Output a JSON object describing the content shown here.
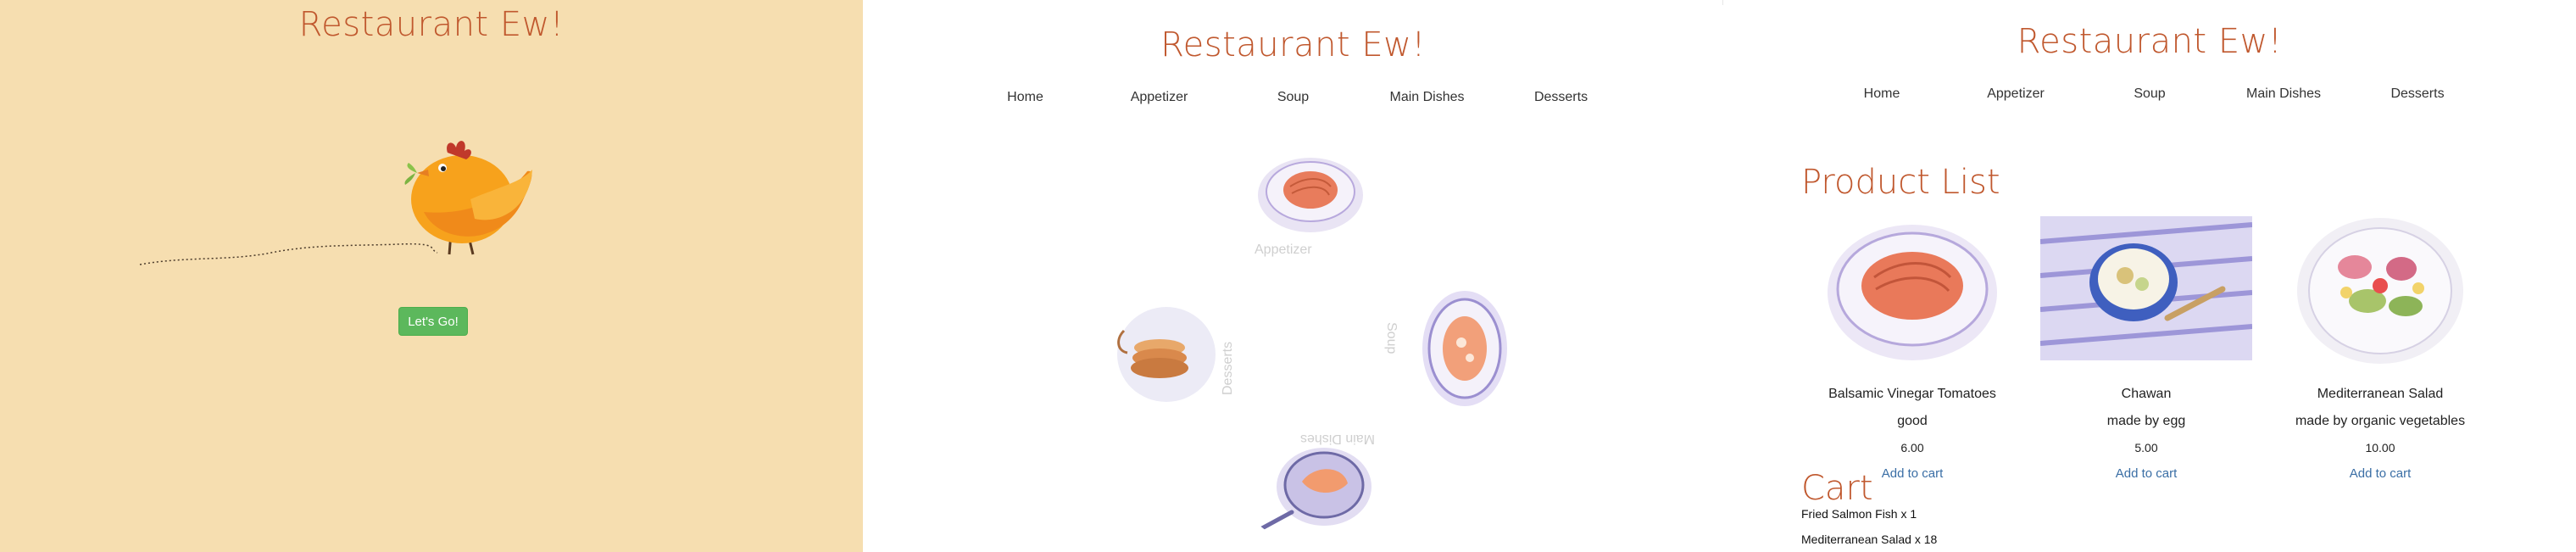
{
  "welcome": {
    "brand": "Restaurant Ew!",
    "cta_label": "Let's Go!"
  },
  "menu_page": {
    "brand": "Restaurant Ew!",
    "nav": [
      "Home",
      "Appetizer",
      "Soup",
      "Main Dishes",
      "Desserts"
    ],
    "wheel_labels": {
      "top": "Appetizer",
      "right": "Soup",
      "bottom": "Main Dishes",
      "left": "Desserts"
    }
  },
  "products_page": {
    "brand": "Restaurant Ew!",
    "nav": [
      "Home",
      "Appetizer",
      "Soup",
      "Main Dishes",
      "Desserts"
    ],
    "product_list_title": "Product List",
    "products": [
      {
        "name": "Balsamic Vinegar Tomatoes",
        "desc": "good",
        "price": "6.00",
        "action": "Add to cart"
      },
      {
        "name": "Chawan",
        "desc": "made by egg",
        "price": "5.00",
        "action": "Add to cart"
      },
      {
        "name": "Mediterranean Salad",
        "desc": "made by organic vegetables",
        "price": "10.00",
        "action": "Add to cart"
      }
    ],
    "cart_title": "Cart",
    "cart_items": [
      "Fried Salmon Fish x 1",
      "Mediterranean Salad x 18"
    ]
  },
  "colors": {
    "welcome_bg": "#f6deb0",
    "brand_color": "#c0582e",
    "button_green": "#5cb85c",
    "link_blue": "#3a6ea5"
  }
}
